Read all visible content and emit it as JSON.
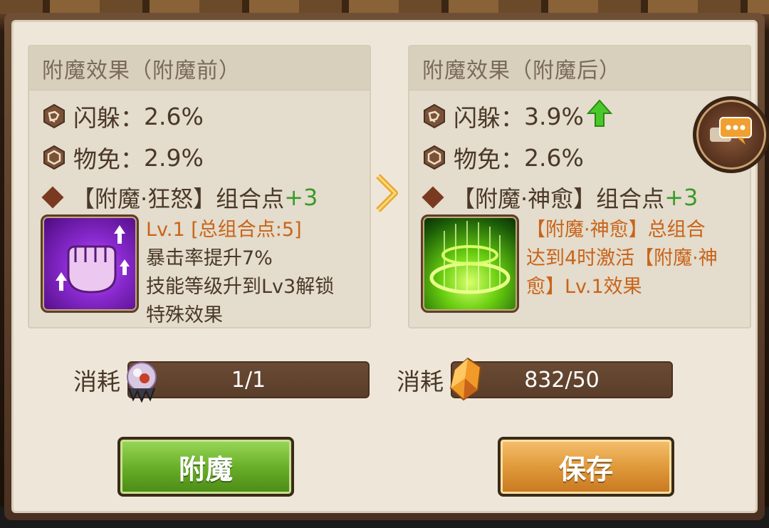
{
  "left_card": {
    "title": "附魔效果（附魔前）",
    "stat1": {
      "icon": "dodge-icon",
      "label": "闪躲：",
      "value": "2.6%"
    },
    "stat2": {
      "icon": "shield-icon",
      "label": "物免：",
      "value": "2.9%"
    },
    "combo": {
      "name": "【附魔·狂怒】组合点",
      "points": "+3"
    },
    "skill": {
      "icon": "fist-icon",
      "level": "Lv.1 [总组合点:5]",
      "line1": "暴击率提升7%",
      "line2": "技能等级升到Lv3解锁",
      "line3": "特殊效果"
    }
  },
  "right_card": {
    "title": "附魔效果（附魔后）",
    "stat1": {
      "icon": "dodge-icon",
      "label": "闪躲：",
      "value": "3.9%",
      "trend": "up-arrow-icon"
    },
    "stat2": {
      "icon": "shield-icon",
      "label": "物免：",
      "value": "2.6%"
    },
    "combo": {
      "name": "【附魔·神愈】组合点",
      "points": "+3"
    },
    "skill": {
      "icon": "heal-ring-icon",
      "desc1": "【附魔·神愈】总组合",
      "desc2": "达到4时激活【附魔·神",
      "desc3": "愈】Lv.1效果"
    }
  },
  "cost_left": {
    "label": "消耗",
    "value": "1/1",
    "icon": "enchant-orb-icon"
  },
  "cost_right": {
    "label": "消耗",
    "value": "832/50",
    "icon": "amber-crystal-icon"
  },
  "buttons": {
    "enchant": "附魔",
    "save": "保存"
  },
  "colors": {
    "positive": "#3a9a2a",
    "highlight": "#c8641a",
    "text": "#4a3828"
  }
}
